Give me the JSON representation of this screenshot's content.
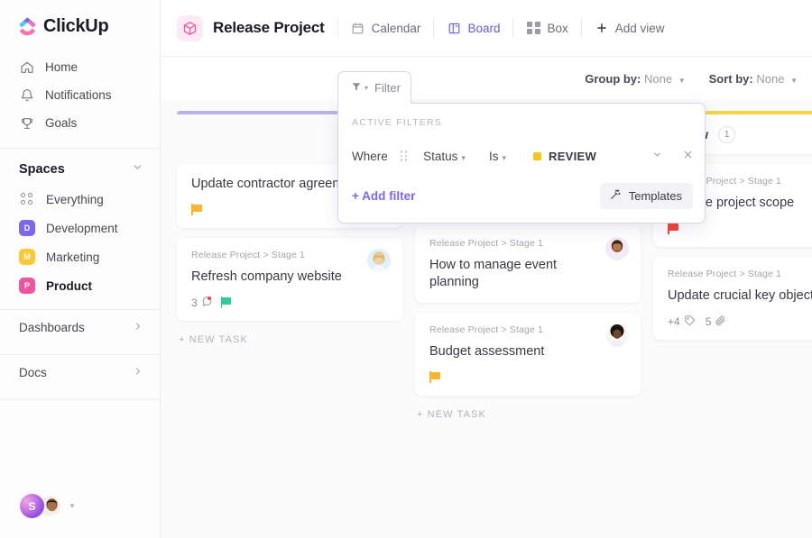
{
  "brand": {
    "name": "ClickUp",
    "accent": "#7b68ee"
  },
  "sidebar": {
    "nav": [
      {
        "label": "Home",
        "icon": "home-icon"
      },
      {
        "label": "Notifications",
        "icon": "bell-icon"
      },
      {
        "label": "Goals",
        "icon": "trophy-icon"
      }
    ],
    "spaces_label": "Spaces",
    "spaces": [
      {
        "label": "Everything",
        "icon": "grid-dots-icon",
        "badge": "",
        "color": ""
      },
      {
        "label": "Development",
        "badge": "D",
        "color": "#7b68ee"
      },
      {
        "label": "Marketing",
        "badge": "M",
        "color": "#fcc936"
      },
      {
        "label": "Product",
        "badge": "P",
        "color": "#f0549c"
      }
    ],
    "active_space": "Product",
    "footer_links": [
      {
        "label": "Dashboards"
      },
      {
        "label": "Docs"
      }
    ],
    "user": {
      "initial": "S"
    }
  },
  "header": {
    "project_title": "Release Project",
    "views": [
      {
        "label": "Calendar",
        "icon": "calendar-icon",
        "active": false
      },
      {
        "label": "Board",
        "icon": "board-icon",
        "active": true
      },
      {
        "label": "Box",
        "icon": "box-grid-icon",
        "active": false
      }
    ],
    "add_view_label": "Add view"
  },
  "toolbar": {
    "group_by_label": "Group by:",
    "group_by_value": "None",
    "sort_by_label": "Sort by:",
    "sort_by_value": "None"
  },
  "filter_panel": {
    "tab_label": "Filter",
    "active_filters_label": "ACTIVE FILTERS",
    "where_label": "Where",
    "field": "Status",
    "operator": "Is",
    "value": "REVIEW",
    "value_color": "#f5c518",
    "add_filter_label": "+ Add filter",
    "templates_label": "Templates"
  },
  "board": {
    "new_task_label": "+ NEW TASK",
    "columns": [
      {
        "name": "",
        "count": "",
        "accent": "#b9b3e8",
        "show_header": false,
        "show_plus": false,
        "new_task": true,
        "cards": [
          {
            "path": "",
            "title": "Update contractor agreement",
            "flag": "#fcb431",
            "avatar": "",
            "meta": []
          },
          {
            "path": "Release Project > Stage 1",
            "title": "Refresh company website",
            "flag": "#2ecc9b",
            "avatar": "female-blonde",
            "meta": [
              {
                "text": "3",
                "icon": "comment-icon"
              }
            ]
          }
        ]
      },
      {
        "name": "",
        "count": "",
        "accent": "#3e8ef7",
        "show_header": true,
        "show_plus": true,
        "new_task": true,
        "cards": [
          {
            "path": "",
            "title": "",
            "flag": "#f2453d",
            "avatar": "female-brunette",
            "meta": []
          },
          {
            "path": "Release Project > Stage 1",
            "title": "How to manage event planning",
            "flag": "",
            "avatar": "male-dark",
            "meta": []
          },
          {
            "path": "Release Project > Stage 1",
            "title": "Budget assessment",
            "flag": "#fcb431",
            "avatar": "male-afro",
            "meta": []
          }
        ]
      },
      {
        "name": "Review",
        "count": "1",
        "accent": "#f5d547",
        "show_header": true,
        "show_plus": false,
        "new_task": false,
        "cards": [
          {
            "path": "Release Project > Stage 1",
            "title": "Finalize project scope",
            "flag": "#f2453d",
            "avatar": "",
            "meta": []
          },
          {
            "path": "Release Project > Stage 1",
            "title": "Update crucial key objectives",
            "flag": "",
            "avatar": "",
            "meta": [
              {
                "text": "+4",
                "icon": "tag-icon"
              },
              {
                "text": "5",
                "icon": "paperclip-icon"
              }
            ]
          }
        ]
      }
    ]
  }
}
